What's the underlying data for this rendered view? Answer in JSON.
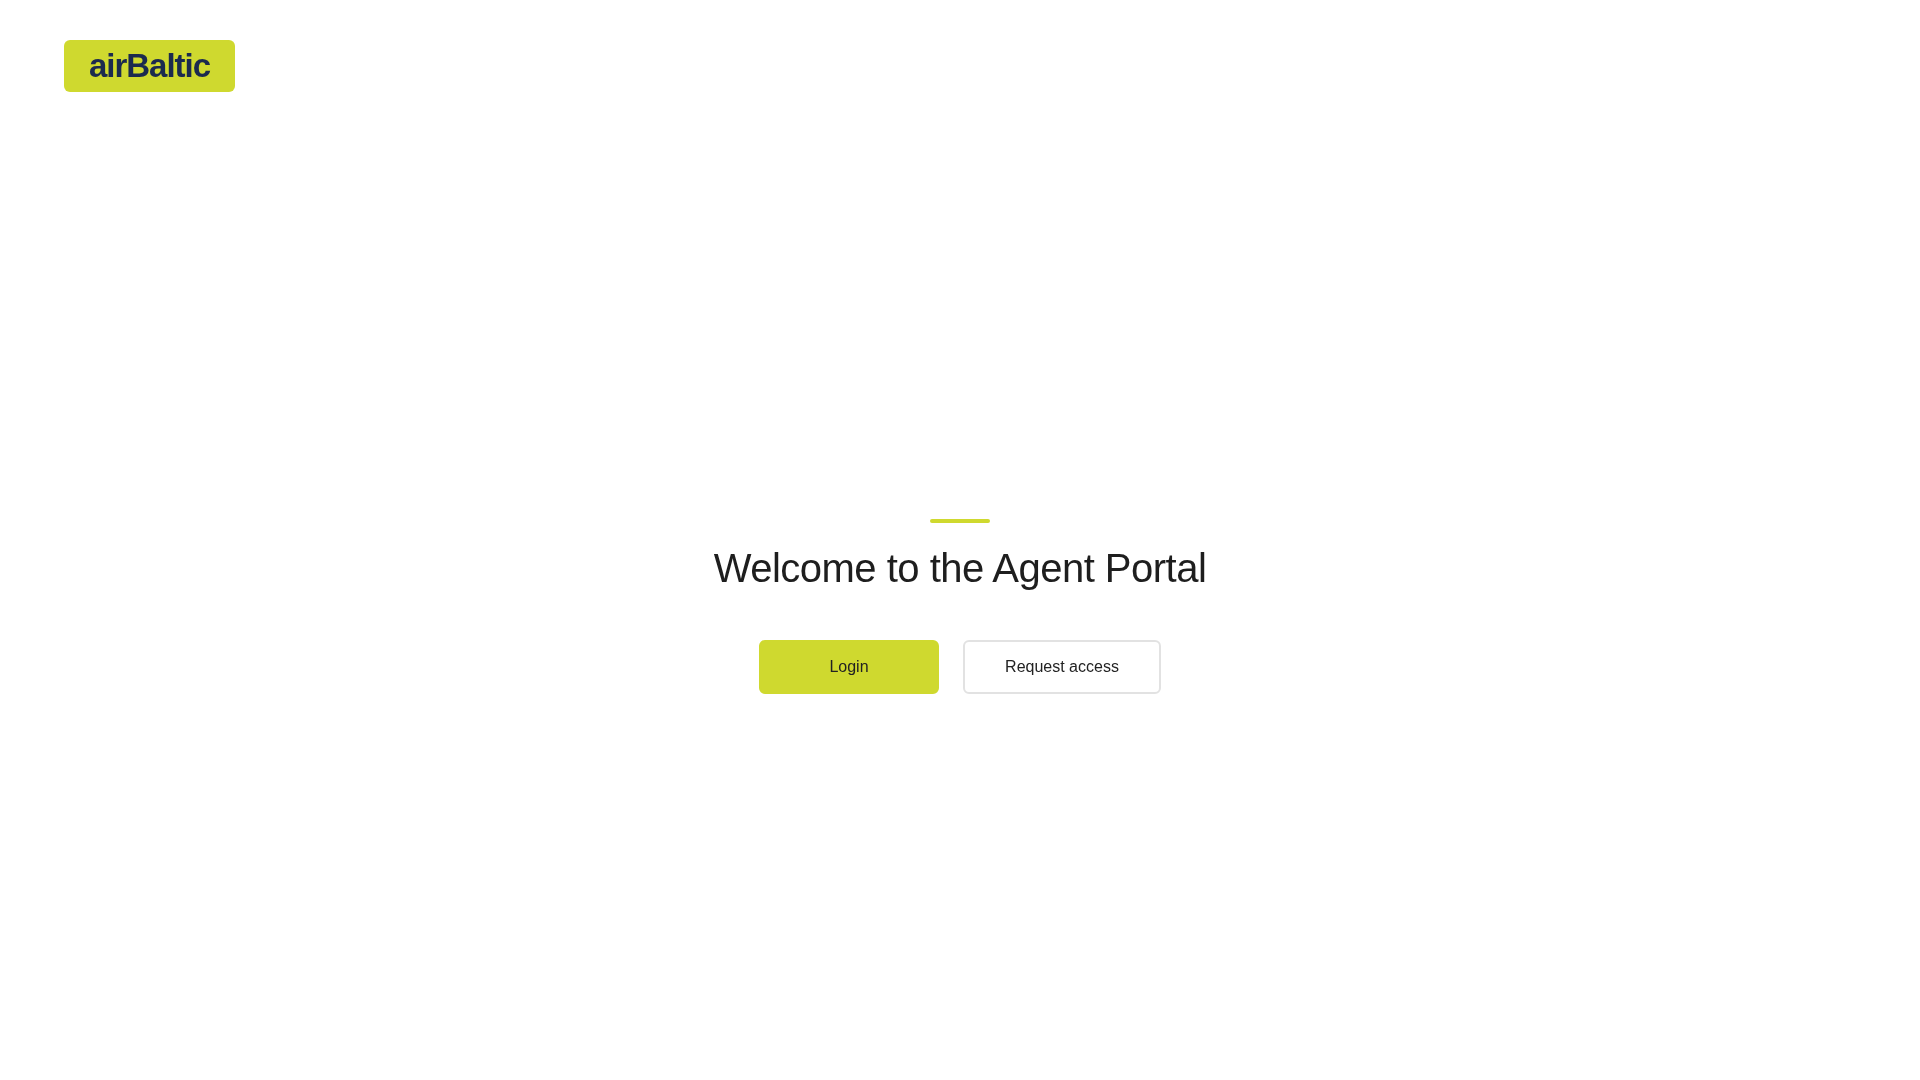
{
  "logo": {
    "text": "airBaltic"
  },
  "heading": "Welcome to the Agent Portal",
  "buttons": [
    {
      "label": "Login",
      "kind": "primary"
    },
    {
      "label": "Request access",
      "kind": "secondary"
    }
  ]
}
